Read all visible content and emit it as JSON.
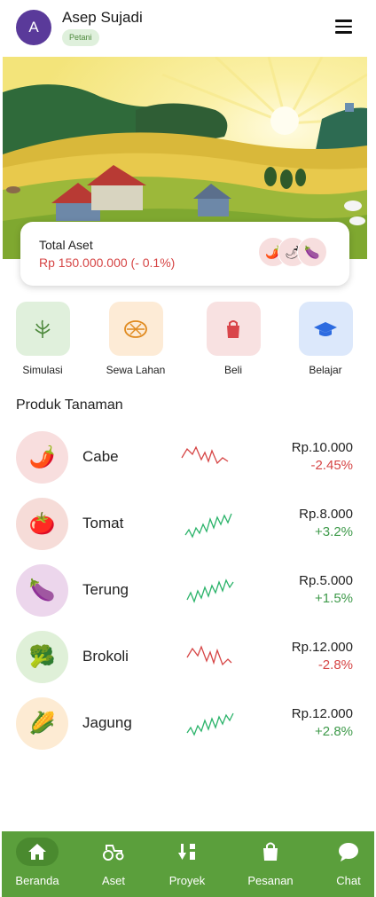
{
  "header": {
    "avatar_initial": "A",
    "user_name": "Asep Sujadi",
    "role": "Petani",
    "menu_icon": "hamburger-menu-icon"
  },
  "asset_card": {
    "label": "Total Aset",
    "value": "Rp 150.000.000 (- 0.1%)",
    "icons": [
      "chili-icon",
      "tomato-icon",
      "eggplant-icon"
    ]
  },
  "actions": [
    {
      "label": "Simulasi",
      "icon": "sprout-icon",
      "color": "#e0f0dc"
    },
    {
      "label": "Sewa Lahan",
      "icon": "land-grid-icon",
      "color": "#fdebd6"
    },
    {
      "label": "Beli",
      "icon": "shopping-bag-icon",
      "color": "#f8e1e1"
    },
    {
      "label": "Belajar",
      "icon": "graduation-cap-icon",
      "color": "#dce8fb"
    }
  ],
  "products_title": "Produk Tanaman",
  "products": [
    {
      "name": "Cabe",
      "icon": "chili-icon",
      "price": "Rp.10.000",
      "change": "-2.45%",
      "trend": "down",
      "icon_bg": "#f8dede"
    },
    {
      "name": "Tomat",
      "icon": "tomato-icon",
      "price": "Rp.8.000",
      "change": "+3.2%",
      "trend": "up",
      "icon_bg": "#f6dcd8"
    },
    {
      "name": "Terung",
      "icon": "eggplant-icon",
      "price": "Rp.5.000",
      "change": "+1.5%",
      "trend": "up",
      "icon_bg": "#ecd6ec"
    },
    {
      "name": "Brokoli",
      "icon": "broccoli-icon",
      "price": "Rp.12.000",
      "change": "-2.8%",
      "trend": "down",
      "icon_bg": "#dff0d8"
    },
    {
      "name": "Jagung",
      "icon": "corn-icon",
      "price": "Rp.12.000",
      "change": "+2.8%",
      "trend": "up",
      "icon_bg": "#fdebd3"
    }
  ],
  "bottom_nav": [
    {
      "label": "Beranda",
      "icon": "home-icon",
      "active": true
    },
    {
      "label": "Aset",
      "icon": "tractor-icon",
      "active": false
    },
    {
      "label": "Proyek",
      "icon": "sort-icon",
      "active": false
    },
    {
      "label": "Pesanan",
      "icon": "shopping-bag-icon",
      "active": false
    },
    {
      "label": "Chat",
      "icon": "chat-bubble-icon",
      "active": false
    }
  ],
  "colors": {
    "accent": "#5b9f3c",
    "negative": "#d64545",
    "positive": "#3e9a4a",
    "avatar": "#5a3a9a"
  }
}
